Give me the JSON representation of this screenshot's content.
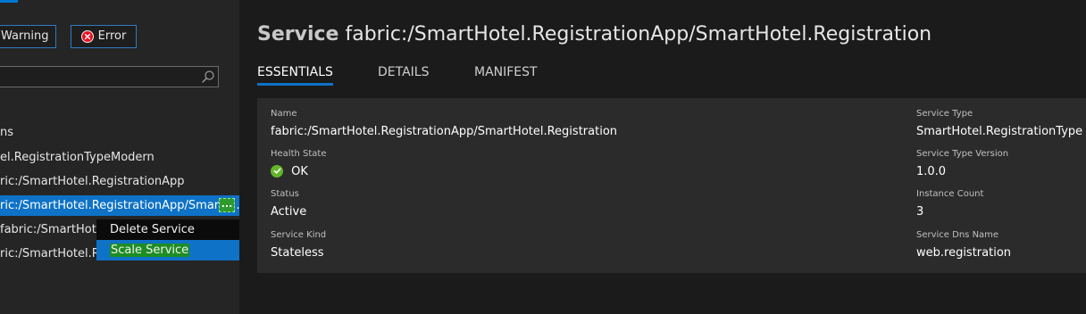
{
  "filters": {
    "warning_label": "Warning",
    "error_label": "Error"
  },
  "search": {
    "value": ""
  },
  "tree": {
    "items": [
      {
        "label": "ns"
      },
      {
        "label": "el.RegistrationTypeModern"
      },
      {
        "label": "ric:/SmartHotel.RegistrationApp"
      },
      {
        "label": "ric:/SmartHotel.RegistrationApp/SmartH…"
      },
      {
        "label": "fabric:/SmartHotel.R"
      },
      {
        "label": "ric:/SmartHotel.Reg"
      }
    ],
    "more_label": "..."
  },
  "context_menu": {
    "items": [
      {
        "label": "Delete Service"
      },
      {
        "label": "Scale Service"
      }
    ]
  },
  "header": {
    "kind": "Service",
    "name": "fabric:/SmartHotel.RegistrationApp/SmartHotel.Registration"
  },
  "tabs": [
    {
      "label": "ESSENTIALS"
    },
    {
      "label": "DETAILS"
    },
    {
      "label": "MANIFEST"
    }
  ],
  "essentials": {
    "name": {
      "label": "Name",
      "value": "fabric:/SmartHotel.RegistrationApp/SmartHotel.Registration"
    },
    "health_state": {
      "label": "Health State",
      "value": "OK"
    },
    "status": {
      "label": "Status",
      "value": "Active"
    },
    "service_kind": {
      "label": "Service Kind",
      "value": "Stateless"
    },
    "service_type": {
      "label": "Service Type",
      "value": "SmartHotel.RegistrationType"
    },
    "service_type_version": {
      "label": "Service Type Version",
      "value": "1.0.0"
    },
    "instance_count": {
      "label": "Instance Count",
      "value": "3"
    },
    "service_dns_name": {
      "label": "Service Dns Name",
      "value": "web.registration"
    }
  },
  "colors": {
    "accent": "#0e72c7",
    "ok": "#64b52a",
    "error": "#e81123",
    "highlight": "#1d8d24"
  }
}
